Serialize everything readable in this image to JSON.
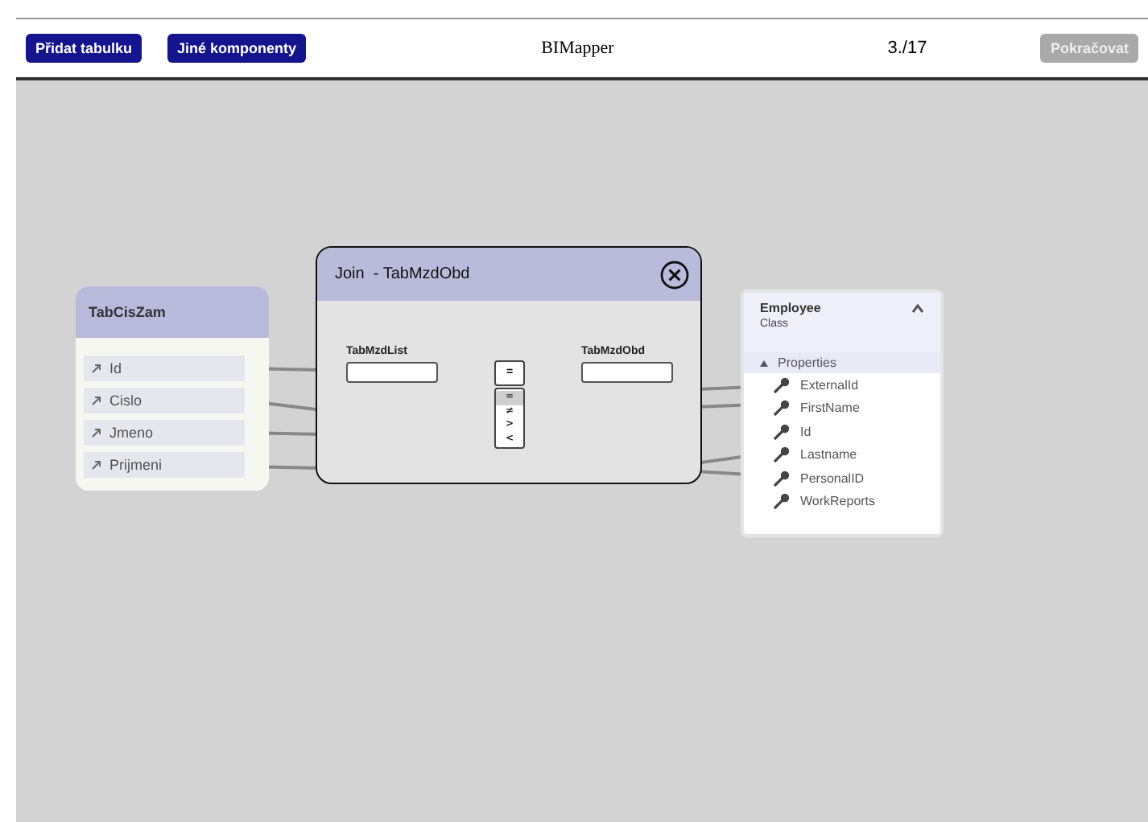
{
  "header": {
    "buttons": [
      {
        "label": "Přidat tabulku",
        "disabled": false
      },
      {
        "label": "Jiné komponenty",
        "disabled": false
      }
    ],
    "title": "BIMapper",
    "progress": "3./17",
    "continue_button": {
      "label": "Pokračovat",
      "disabled": true
    }
  },
  "canvas": {
    "tables": [
      {
        "kind": "entity",
        "title": "TabCisZam",
        "fields": [
          "Id",
          "Cislo",
          "Jmeno",
          "Prijmeni"
        ]
      },
      {
        "kind": "class",
        "title": "Employee",
        "subtitle": "Class",
        "section": "Properties",
        "fields": [
          "ExternalId",
          "FirstName",
          "Id",
          "Lastname",
          "PersonalID",
          "WorkReports"
        ]
      }
    ]
  },
  "dialog": {
    "title": "Join  - TabMzdObd",
    "left_label": "TabMzdList",
    "right_label": "TabMzdObd",
    "operator": "=",
    "operators": [
      {
        "label": "=",
        "selected": true
      },
      {
        "label": "≠",
        "selected": false
      },
      {
        "label": ">",
        "selected": false
      },
      {
        "label": "<",
        "selected": false
      }
    ]
  }
}
